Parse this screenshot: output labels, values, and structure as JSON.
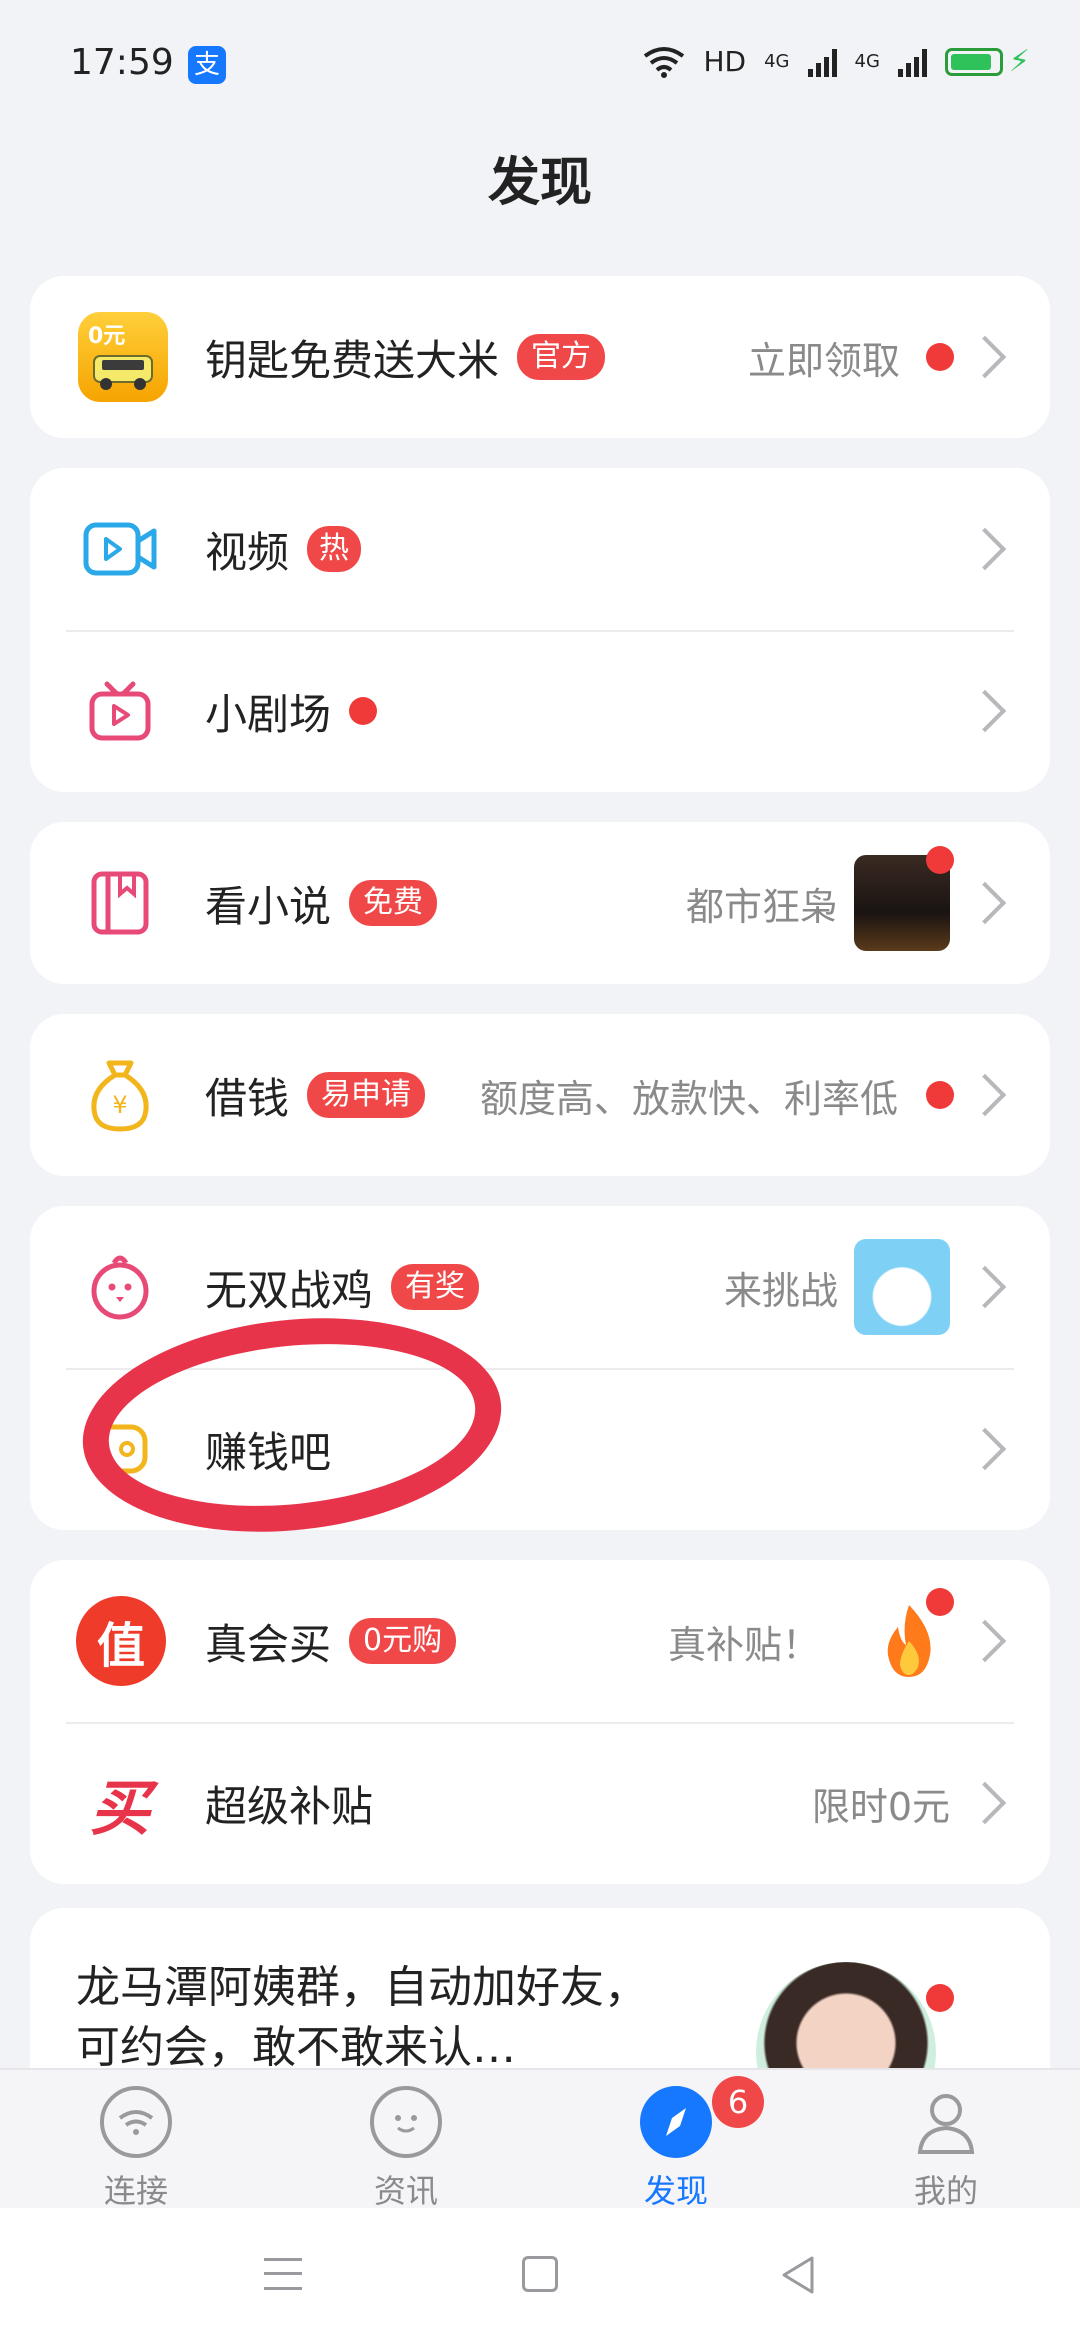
{
  "status_bar": {
    "time": "17:59",
    "network": "HD",
    "sim1": "4G",
    "sim2": "4G"
  },
  "page_title": "发现",
  "promo": {
    "label": "钥匙免费送大米",
    "tag": "官方",
    "action": "立即领取",
    "icon_text": "0元"
  },
  "video": {
    "label": "视频",
    "tag": "热"
  },
  "theater": {
    "label": "小剧场"
  },
  "novel": {
    "label": "看小说",
    "tag": "免费",
    "sub": "都市狂枭"
  },
  "loan": {
    "label": "借钱",
    "tag": "易申请",
    "sub": "额度高、放款快、利率低"
  },
  "game": {
    "label": "无双战鸡",
    "tag": "有奖",
    "sub": "来挑战"
  },
  "earn": {
    "label": "赚钱吧"
  },
  "deal": {
    "label": "真会买",
    "tag": "0元购",
    "sub": "真补贴！",
    "icon_text": "值"
  },
  "subsidy": {
    "label": "超级补贴",
    "sub": "限时0元",
    "icon_text": "买"
  },
  "post": {
    "text": "龙马潭阿姨群，自动加好友，可约会，敢不敢来认…"
  },
  "nav": {
    "items": [
      {
        "label": "连接"
      },
      {
        "label": "资讯"
      },
      {
        "label": "发现"
      },
      {
        "label": "我的"
      }
    ],
    "badge": "6"
  },
  "colors": {
    "accent": "#1677ff",
    "red": "#f04848",
    "annotation": "#e8344a"
  }
}
